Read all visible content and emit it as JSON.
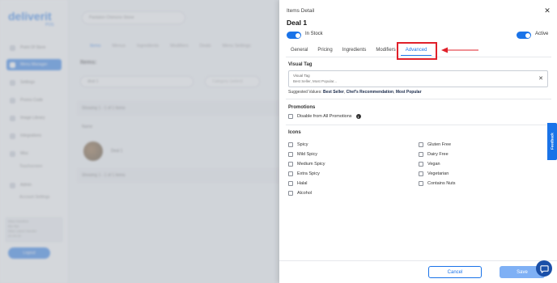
{
  "background": {
    "logo": "deliverit",
    "logo_sub": "POS",
    "sidebar": [
      "Point Of Store",
      "Menu Manager",
      "Settings",
      "Promo Code",
      "Image Library",
      "Integrations",
      "Misc",
      "Admin"
    ],
    "sidebar_sub": [
      "Touchscreen",
      "Account Settings"
    ],
    "store_select": "Pantalon Chimono Stone",
    "tabs": [
      "Items",
      "Menus",
      "Ingredients",
      "Modifiers",
      "Deals",
      "Menu Settings"
    ],
    "items_title": "Items:",
    "search_value": "deal 1",
    "category_placeholder": "Category (select)",
    "showing_top": "Showing 1 - 1 of 1 items",
    "name_header": "Name",
    "deal_name": "Deal 1",
    "showing_bottom": "Showing 1 - 1 of 1 items",
    "user_lines": [
      "Mike Hamilton",
      "Bar Bar",
      "Mike Latest Handler",
      "21-04-22"
    ],
    "logout": "Logout"
  },
  "panel": {
    "label": "Items Detail",
    "title": "Deal 1",
    "in_stock_label": "In Stock",
    "active_label": "Active",
    "tabs": [
      "General",
      "Pricing",
      "Ingredients",
      "Modifiers",
      "Advanced"
    ],
    "active_tab": "Advanced",
    "visual_tag": {
      "section": "Visual Tag",
      "field_label": "Visual Tag",
      "placeholder": "Best Seller, Most Popular...",
      "suggested_prefix": "Suggested Values: ",
      "suggested": [
        "Best Seller",
        "Chef's Recommendation",
        "Most Popular"
      ]
    },
    "promotions": {
      "section": "Promotions",
      "disable_label": "Disable from All Promotions"
    },
    "icons": {
      "section": "Icons",
      "left": [
        "Spicy",
        "Mild Spicy",
        "Medium Spicy",
        "Extra Spicy",
        "Halal",
        "Alcohol"
      ],
      "right": [
        "Gluten Free",
        "Dairy Free",
        "Vegan",
        "Vegetarian",
        "Contains Nuts"
      ]
    },
    "cancel": "Cancel",
    "save": "Save"
  },
  "feedback": "Feedback",
  "colors": {
    "accent": "#1a73e8",
    "highlight": "#e0202a"
  }
}
